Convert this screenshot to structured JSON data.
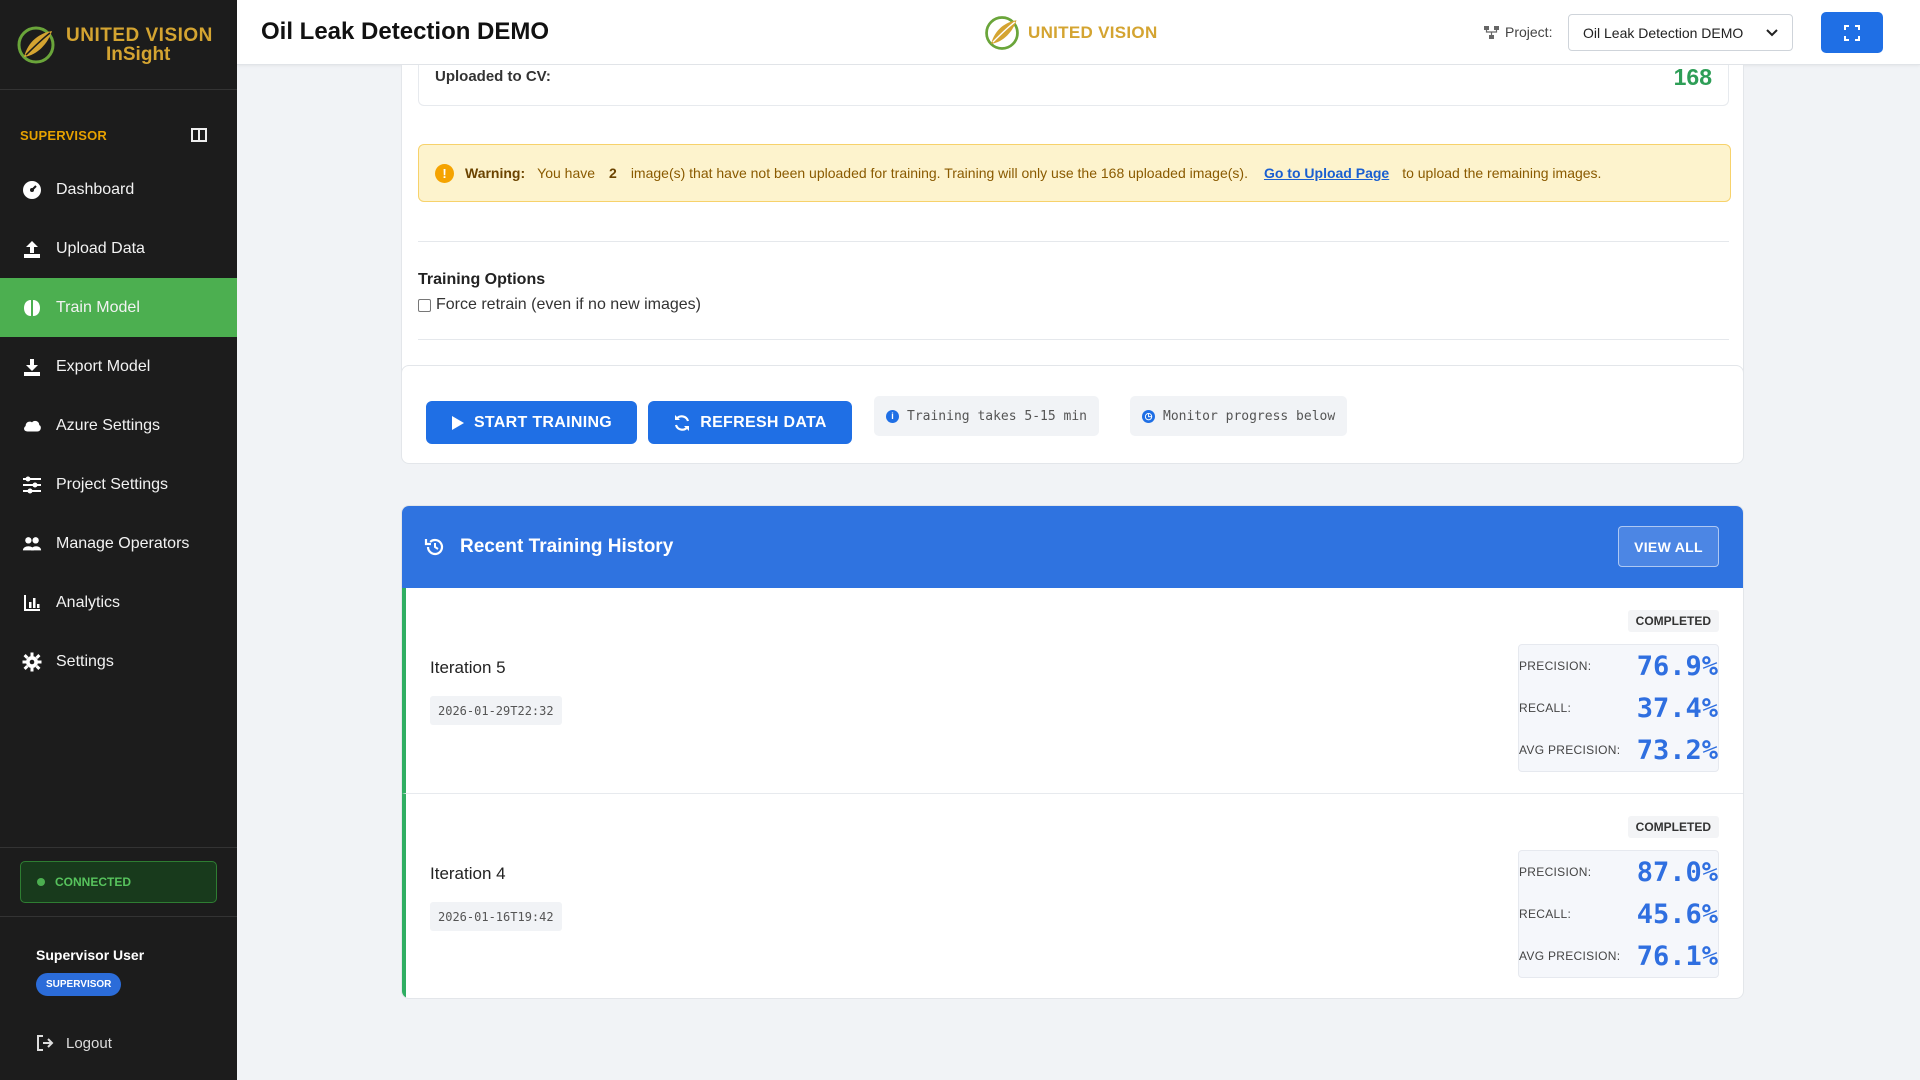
{
  "sidebar": {
    "brand_line1": "UNITED VISION",
    "brand_line2": "InSight",
    "role": "SUPERVISOR",
    "items": [
      {
        "label": "Dashboard",
        "icon": "gauge-icon"
      },
      {
        "label": "Upload Data",
        "icon": "upload-icon"
      },
      {
        "label": "Train Model",
        "icon": "brain-icon",
        "active": true
      },
      {
        "label": "Export Model",
        "icon": "download-icon"
      },
      {
        "label": "Azure Settings",
        "icon": "cloud-icon"
      },
      {
        "label": "Project Settings",
        "icon": "sliders-icon"
      },
      {
        "label": "Manage Operators",
        "icon": "users-icon"
      },
      {
        "label": "Analytics",
        "icon": "chart-icon"
      },
      {
        "label": "Settings",
        "icon": "gear-icon"
      }
    ],
    "connection": "CONNECTED",
    "user_name": "Supervisor User",
    "user_badge": "SUPERVISOR",
    "logout": "Logout"
  },
  "header": {
    "title": "Oil Leak Detection DEMO",
    "center_brand": "UNITED VISION",
    "project_label": "Project:",
    "project_selected": "Oil Leak Detection DEMO"
  },
  "upload_summary": {
    "label": "Uploaded to CV:",
    "value": "168"
  },
  "warning": {
    "label": "Warning:",
    "text1": "You have",
    "count": "2",
    "text2": "image(s) that have not been uploaded for training. Training will only use the 168 uploaded image(s).",
    "link": "Go to Upload Page",
    "text3": "to upload the remaining images."
  },
  "training_options": {
    "title": "Training Options",
    "force_retrain": "Force retrain (even if no new images)",
    "force_retrain_checked": false
  },
  "actions": {
    "start": "START TRAINING",
    "refresh": "REFRESH DATA",
    "hint1": "Training takes 5-15 min",
    "hint2": "Monitor progress below"
  },
  "history": {
    "title": "Recent Training History",
    "view_all": "VIEW ALL",
    "labels": {
      "precision": "PRECISION:",
      "recall": "RECALL:",
      "avg_precision": "AVG PRECISION:"
    },
    "iterations": [
      {
        "name": "Iteration 5",
        "date": "2026-01-29T22:32",
        "status": "COMPLETED",
        "precision": "76.9%",
        "recall": "37.4%",
        "avg_precision": "73.2%"
      },
      {
        "name": "Iteration 4",
        "date": "2026-01-16T19:42",
        "status": "COMPLETED",
        "precision": "87.0%",
        "recall": "45.6%",
        "avg_precision": "76.1%"
      }
    ]
  },
  "colors": {
    "sidebar_bg": "#1c1c1c",
    "active_nav": "#4caf50",
    "primary": "#1f6fe5",
    "brand_gold": "#d4a431",
    "success_text": "#2e9e57"
  }
}
